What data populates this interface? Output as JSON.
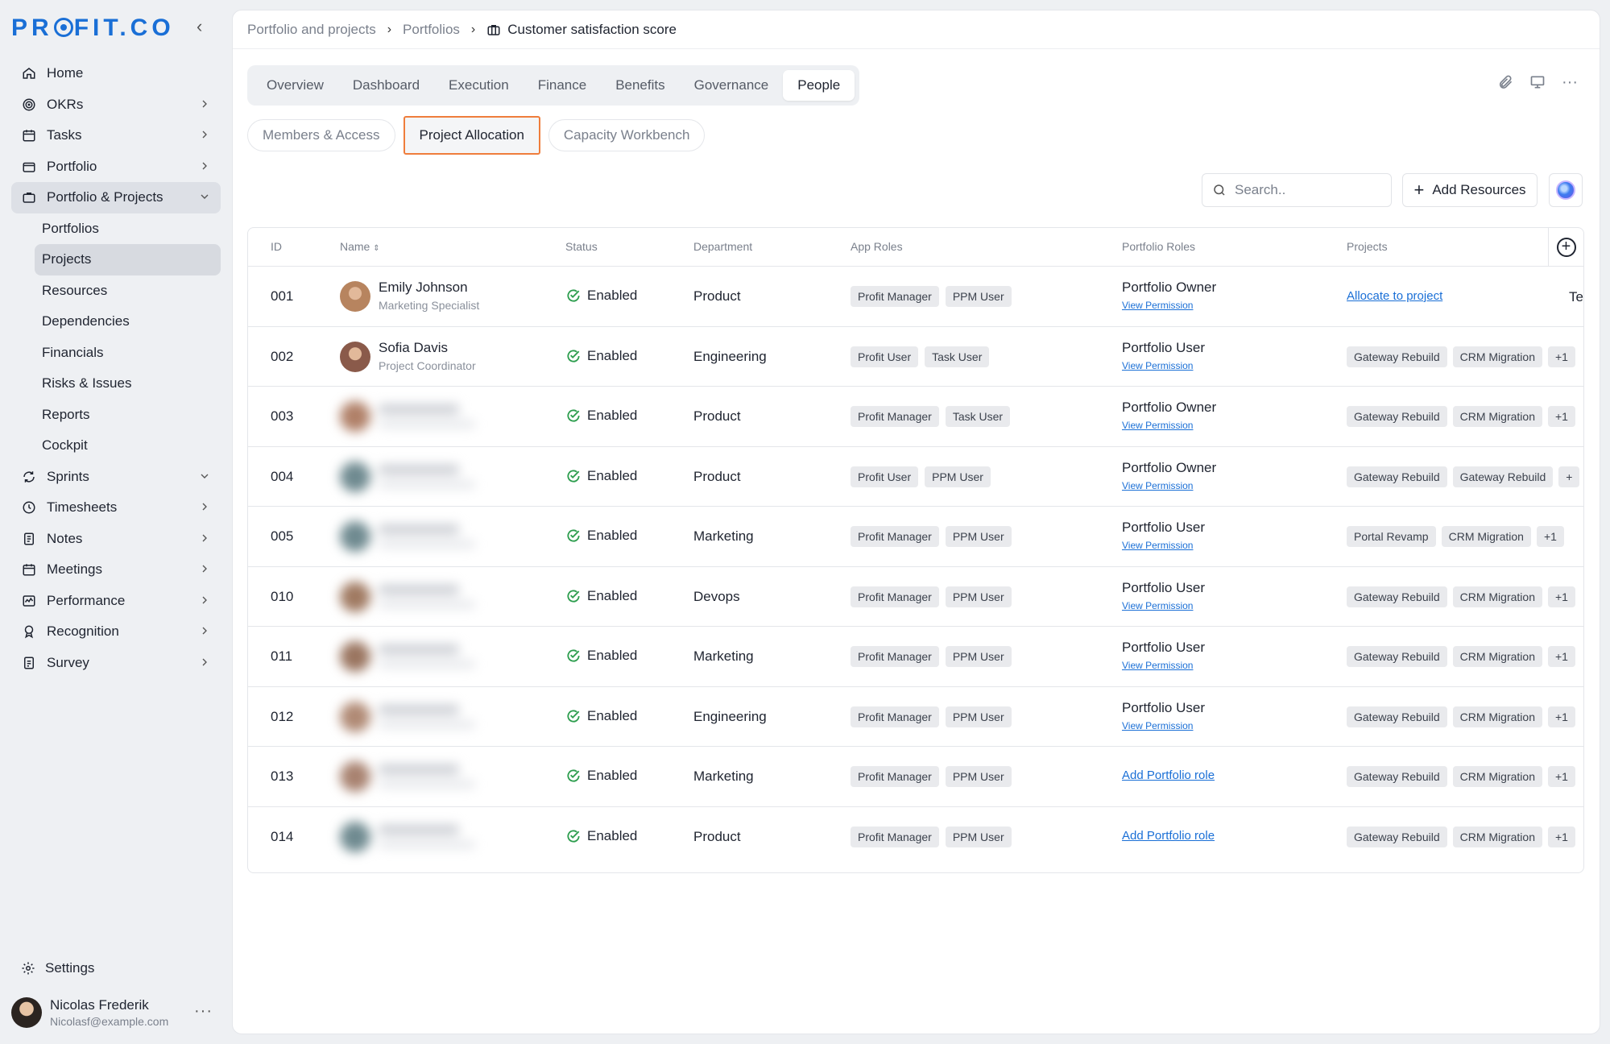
{
  "logo": "PR  FIT.CO",
  "sidebar": {
    "items": [
      {
        "label": "Home",
        "icon": "home-icon",
        "chev": ""
      },
      {
        "label": "OKRs",
        "icon": "target-icon",
        "chev": "right"
      },
      {
        "label": "Tasks",
        "icon": "calendar-icon",
        "chev": "right"
      },
      {
        "label": "Portfolio",
        "icon": "folder-icon",
        "chev": "right"
      },
      {
        "label": "Portfolio & Projects",
        "icon": "briefcase-icon",
        "chev": "down"
      }
    ],
    "sub_items": [
      "Portfolios",
      "Projects",
      "Resources",
      "Dependencies",
      "Financials",
      "Risks & Issues",
      "Reports",
      "Cockpit"
    ],
    "items_after": [
      {
        "label": "Sprints",
        "icon": "sprint-icon",
        "chev": "down"
      },
      {
        "label": "Timesheets",
        "icon": "clock-icon",
        "chev": "right"
      },
      {
        "label": "Notes",
        "icon": "notes-icon",
        "chev": "right"
      },
      {
        "label": "Meetings",
        "icon": "calendar-icon",
        "chev": "right"
      },
      {
        "label": "Performance",
        "icon": "performance-icon",
        "chev": "right"
      },
      {
        "label": "Recognition",
        "icon": "award-icon",
        "chev": "right"
      },
      {
        "label": "Survey",
        "icon": "survey-icon",
        "chev": "right"
      }
    ],
    "settings": "Settings",
    "user": {
      "name": "Nicolas Frederik",
      "email": "Nicolasf@example.com"
    }
  },
  "breadcrumb": {
    "first": "Portfolio and projects",
    "second": "Portfolios",
    "current": "Customer satisfaction score"
  },
  "tabs": [
    "Overview",
    "Dashboard",
    "Execution",
    "Finance",
    "Benefits",
    "Governance",
    "People"
  ],
  "active_tab": "People",
  "subtabs": [
    "Members & Access",
    "Project Allocation",
    "Capacity Workbench"
  ],
  "active_subtab": "Project Allocation",
  "search": {
    "placeholder": "Search.."
  },
  "add_resources": "Add Resources",
  "table": {
    "headers": {
      "id": "ID",
      "name": "Name",
      "status": "Status",
      "department": "Department",
      "app_roles": "App Roles",
      "portfolio_roles": "Portfolio Roles",
      "projects": "Projects"
    },
    "view_permission": "View Permission",
    "add_portfolio_role": "Add Portfolio role",
    "allocate": "Allocate to project",
    "rows": [
      {
        "id": "001",
        "name": "Emily Johnson",
        "role": "Marketing Specialist",
        "status": "Enabled",
        "department": "Product",
        "app_roles": [
          "Profit Manager",
          "PPM User"
        ],
        "portfolio_role": "Portfolio Owner",
        "projects": [],
        "extra": "Te",
        "avatar": "#b7845f"
      },
      {
        "id": "002",
        "name": "Sofia Davis",
        "role": "Project Coordinator",
        "status": "Enabled",
        "department": "Engineering",
        "app_roles": [
          "Profit User",
          "Task User"
        ],
        "portfolio_role": "Portfolio User",
        "projects": [
          "Gateway Rebuild",
          "CRM Migration",
          "+1"
        ],
        "avatar": "#8a5a4a"
      },
      {
        "id": "003",
        "name": "",
        "role": "",
        "status": "Enabled",
        "department": "Product",
        "app_roles": [
          "Profit Manager",
          "Task User"
        ],
        "portfolio_role": "Portfolio Owner",
        "projects": [
          "Gateway Rebuild",
          "CRM Migration",
          "+1"
        ],
        "avatar": "#b08068"
      },
      {
        "id": "004",
        "name": "",
        "role": "",
        "status": "Enabled",
        "department": "Product",
        "app_roles": [
          "Profit User",
          "PPM User"
        ],
        "portfolio_role": "Portfolio Owner",
        "projects": [
          "Gateway Rebuild",
          "Gateway Rebuild",
          "+"
        ],
        "avatar": "#6f8a90"
      },
      {
        "id": "005",
        "name": "",
        "role": "",
        "status": "Enabled",
        "department": "Marketing",
        "app_roles": [
          "Profit Manager",
          "PPM User"
        ],
        "portfolio_role": "Portfolio User",
        "projects": [
          "Portal Revamp",
          "CRM Migration",
          "+1"
        ],
        "avatar": "#6f8a90"
      },
      {
        "id": "010",
        "name": "",
        "role": "",
        "status": "Enabled",
        "department": "Devops",
        "app_roles": [
          "Profit Manager",
          "PPM User"
        ],
        "portfolio_role": "Portfolio User",
        "projects": [
          "Gateway Rebuild",
          "CRM Migration",
          "+1"
        ],
        "avatar": "#a07a62"
      },
      {
        "id": "011",
        "name": "",
        "role": "",
        "status": "Enabled",
        "department": "Marketing",
        "app_roles": [
          "Profit Manager",
          "PPM User"
        ],
        "portfolio_role": "Portfolio User",
        "projects": [
          "Gateway Rebuild",
          "CRM Migration",
          "+1"
        ],
        "avatar": "#9a7560"
      },
      {
        "id": "012",
        "name": "",
        "role": "",
        "status": "Enabled",
        "department": "Engineering",
        "app_roles": [
          "Profit Manager",
          "PPM User"
        ],
        "portfolio_role": "Portfolio User",
        "projects": [
          "Gateway Rebuild",
          "CRM Migration",
          "+1"
        ],
        "avatar": "#b08a75"
      },
      {
        "id": "013",
        "name": "",
        "role": "",
        "status": "Enabled",
        "department": "Marketing",
        "app_roles": [
          "Profit Manager",
          "PPM User"
        ],
        "portfolio_role": "",
        "projects": [
          "Gateway Rebuild",
          "CRM Migration",
          "+1"
        ],
        "avatar": "#a88270"
      },
      {
        "id": "014",
        "name": "",
        "role": "",
        "status": "Enabled",
        "department": "Product",
        "app_roles": [
          "Profit Manager",
          "PPM User"
        ],
        "portfolio_role": "",
        "projects": [
          "Gateway Rebuild",
          "CRM Migration",
          "+1"
        ],
        "avatar": "#6f8a90"
      }
    ]
  },
  "colors": {
    "accent": "#1a6fd6",
    "active_subtab_border": "#ef7d3c",
    "enabled_green": "#2e9e4f"
  }
}
